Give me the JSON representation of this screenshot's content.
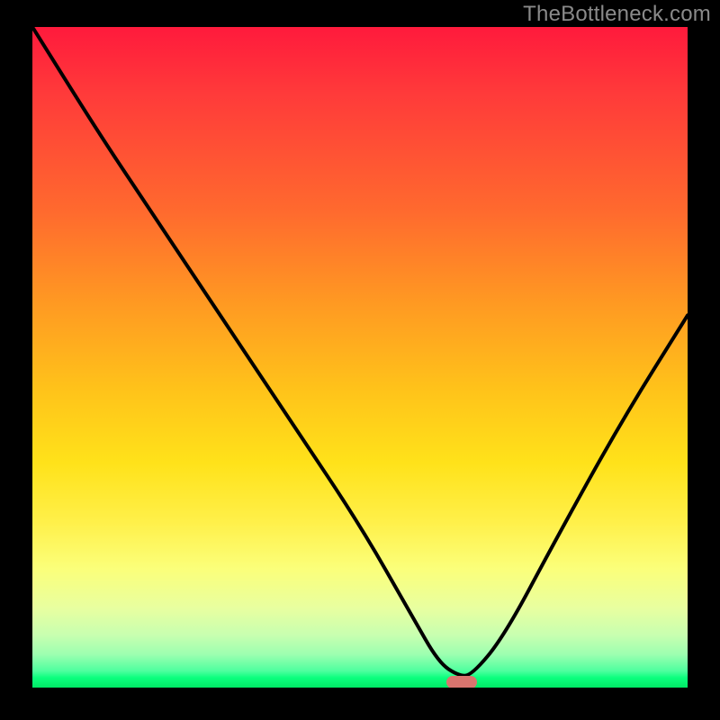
{
  "watermark": "TheBottleneck.com",
  "colors": {
    "page_bg": "#000000",
    "watermark_text": "#8a8a8a",
    "curve_stroke": "#000000",
    "marker_fill": "#d9746e",
    "gradient_stops": [
      "#ff1a3c",
      "#ff3a3a",
      "#ff6a2e",
      "#ff9a22",
      "#ffc31a",
      "#ffe21a",
      "#fff04a",
      "#fbff7a",
      "#e8ffa0",
      "#c8ffb0",
      "#9cffb0",
      "#4dff9e",
      "#0cff7e",
      "#00e865"
    ]
  },
  "chart_data": {
    "type": "line",
    "title": "",
    "xlabel": "",
    "ylabel": "",
    "xlim": [
      0,
      100
    ],
    "ylim": [
      0,
      100
    ],
    "grid": false,
    "legend": null,
    "background": "vertical-gradient-red-to-green",
    "series": [
      {
        "name": "bottleneck-curve",
        "x": [
          0,
          10,
          18,
          30,
          40,
          50,
          58,
          62,
          65,
          67,
          72,
          80,
          90,
          100
        ],
        "y": [
          100,
          84,
          72,
          54,
          39,
          24,
          10,
          3,
          1,
          1,
          7,
          22,
          40,
          56
        ]
      }
    ],
    "annotations": [
      {
        "name": "optimal-point-marker",
        "x": 65.5,
        "y": 0.8,
        "shape": "pill",
        "color": "#d9746e"
      }
    ],
    "notes": "Axes have no visible labels or ticks; plot sits inside a thick black frame. y=0 at bottom (green), y=100 at top (red)."
  }
}
